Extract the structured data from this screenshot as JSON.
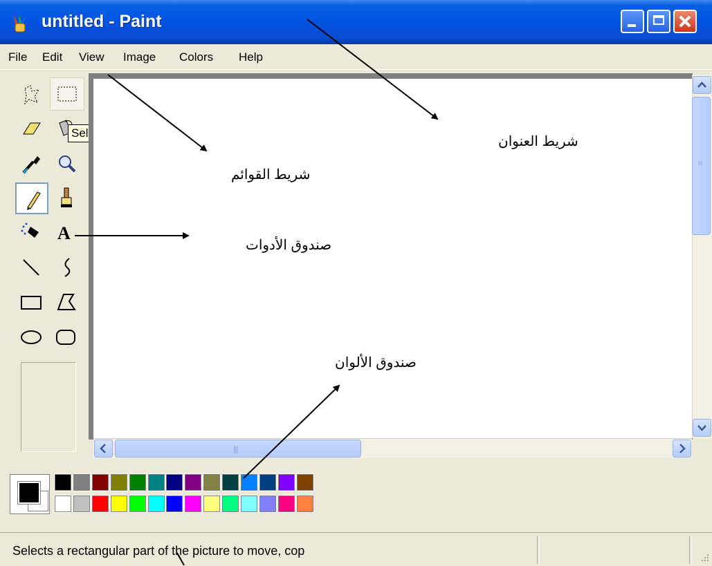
{
  "window": {
    "title": "untitled - Paint",
    "controls": [
      "minimize",
      "maximize",
      "close"
    ]
  },
  "menu": [
    "File",
    "Edit",
    "View",
    "Image",
    "Colors",
    "Help"
  ],
  "toolbox": {
    "tools": [
      {
        "name": "free-form-select",
        "icon": "free-form-select-icon"
      },
      {
        "name": "select",
        "icon": "rectangle-select-icon",
        "hovered": true
      },
      {
        "name": "eraser",
        "icon": "eraser-icon"
      },
      {
        "name": "fill",
        "icon": "fill-bucket-icon"
      },
      {
        "name": "pick-color",
        "icon": "eyedropper-icon"
      },
      {
        "name": "magnifier",
        "icon": "magnifier-icon"
      },
      {
        "name": "pencil",
        "icon": "pencil-icon",
        "active": true
      },
      {
        "name": "brush",
        "icon": "brush-icon"
      },
      {
        "name": "airbrush",
        "icon": "airbrush-icon"
      },
      {
        "name": "text",
        "icon": "text-icon",
        "glyph": "A"
      },
      {
        "name": "line",
        "icon": "line-icon"
      },
      {
        "name": "curve",
        "icon": "curve-icon"
      },
      {
        "name": "rectangle",
        "icon": "rectangle-icon"
      },
      {
        "name": "polygon",
        "icon": "polygon-icon"
      },
      {
        "name": "ellipse",
        "icon": "ellipse-icon"
      },
      {
        "name": "rounded-rectangle",
        "icon": "rounded-rectangle-icon"
      }
    ],
    "tooltip": "Select"
  },
  "palette": {
    "foreground": "#000000",
    "background": "#ffffff",
    "top_row": [
      "#000000",
      "#808080",
      "#800000",
      "#808000",
      "#008000",
      "#008080",
      "#000080",
      "#800080",
      "#808040",
      "#004040",
      "#0080ff",
      "#004080",
      "#8000ff",
      "#804000"
    ],
    "bottom_row": [
      "#ffffff",
      "#c0c0c0",
      "#ff0000",
      "#ffff00",
      "#00ff00",
      "#00ffff",
      "#0000ff",
      "#ff00ff",
      "#ffff80",
      "#00ff80",
      "#80ffff",
      "#8080ff",
      "#ff0080",
      "#ff8040"
    ]
  },
  "statusbar": {
    "text": "Selects a rectangular part of the picture to move, cop"
  },
  "annotations": {
    "title_bar": "شريط العنوان",
    "menu_bar": "شريط القوائم",
    "toolbox": "صندوق الأدوات",
    "color_box": "صندوق الألوان"
  },
  "colors": {
    "titlebar": "#0053e2",
    "chrome": "#ece9d8",
    "scrollbar_thumb": "#c4d8ff"
  }
}
